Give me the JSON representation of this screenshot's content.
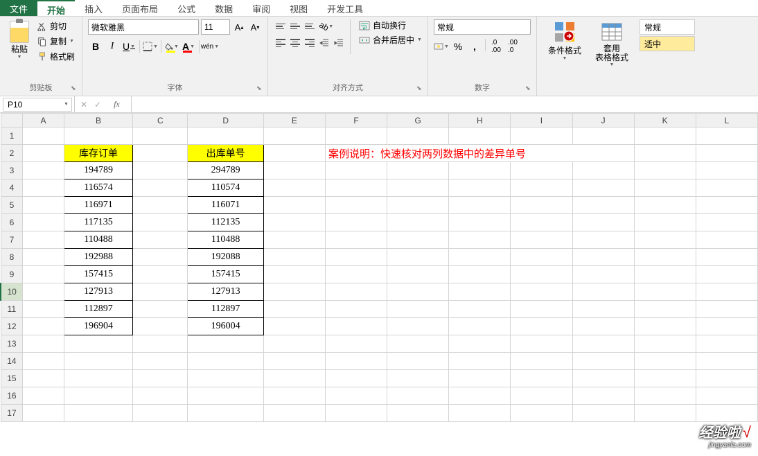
{
  "menu": {
    "file": "文件",
    "tabs": [
      "开始",
      "插入",
      "页面布局",
      "公式",
      "数据",
      "审阅",
      "视图",
      "开发工具"
    ]
  },
  "ribbon": {
    "clipboard": {
      "paste": "粘贴",
      "cut": "剪切",
      "copy": "复制",
      "format_painter": "格式刷",
      "label": "剪贴板"
    },
    "font": {
      "name": "微软雅黑",
      "size": "11",
      "label": "字体",
      "bold": "B",
      "italic": "I",
      "underline": "U",
      "wen": "wén"
    },
    "alignment": {
      "wrap": "自动换行",
      "merge": "合并后居中",
      "label": "对齐方式"
    },
    "number": {
      "format": "常规",
      "label": "数字"
    },
    "styles": {
      "conditional": "条件格式",
      "table": "套用\n表格格式",
      "normal": "常规",
      "good": "适中"
    }
  },
  "formula_bar": {
    "name_box": "P10",
    "fx": "fx",
    "value": ""
  },
  "columns": [
    "A",
    "B",
    "C",
    "D",
    "E",
    "F",
    "G",
    "H",
    "I",
    "J",
    "K",
    "L"
  ],
  "rows": [
    1,
    2,
    3,
    4,
    5,
    6,
    7,
    8,
    9,
    10,
    11,
    12,
    13,
    14,
    15,
    16,
    17
  ],
  "sheet": {
    "header_b": "库存订单",
    "header_d": "出库单号",
    "col_b": [
      "194789",
      "116574",
      "116971",
      "117135",
      "110488",
      "192988",
      "157415",
      "127913",
      "112897",
      "196904"
    ],
    "col_d": [
      "294789",
      "110574",
      "116071",
      "112135",
      "110488",
      "192088",
      "157415",
      "127913",
      "112897",
      "196004"
    ],
    "explain": "案例说明：快速核对两列数据中的差异单号"
  },
  "watermark": {
    "main": "经验啦",
    "check": "√",
    "sub": "jingyanla.com"
  }
}
